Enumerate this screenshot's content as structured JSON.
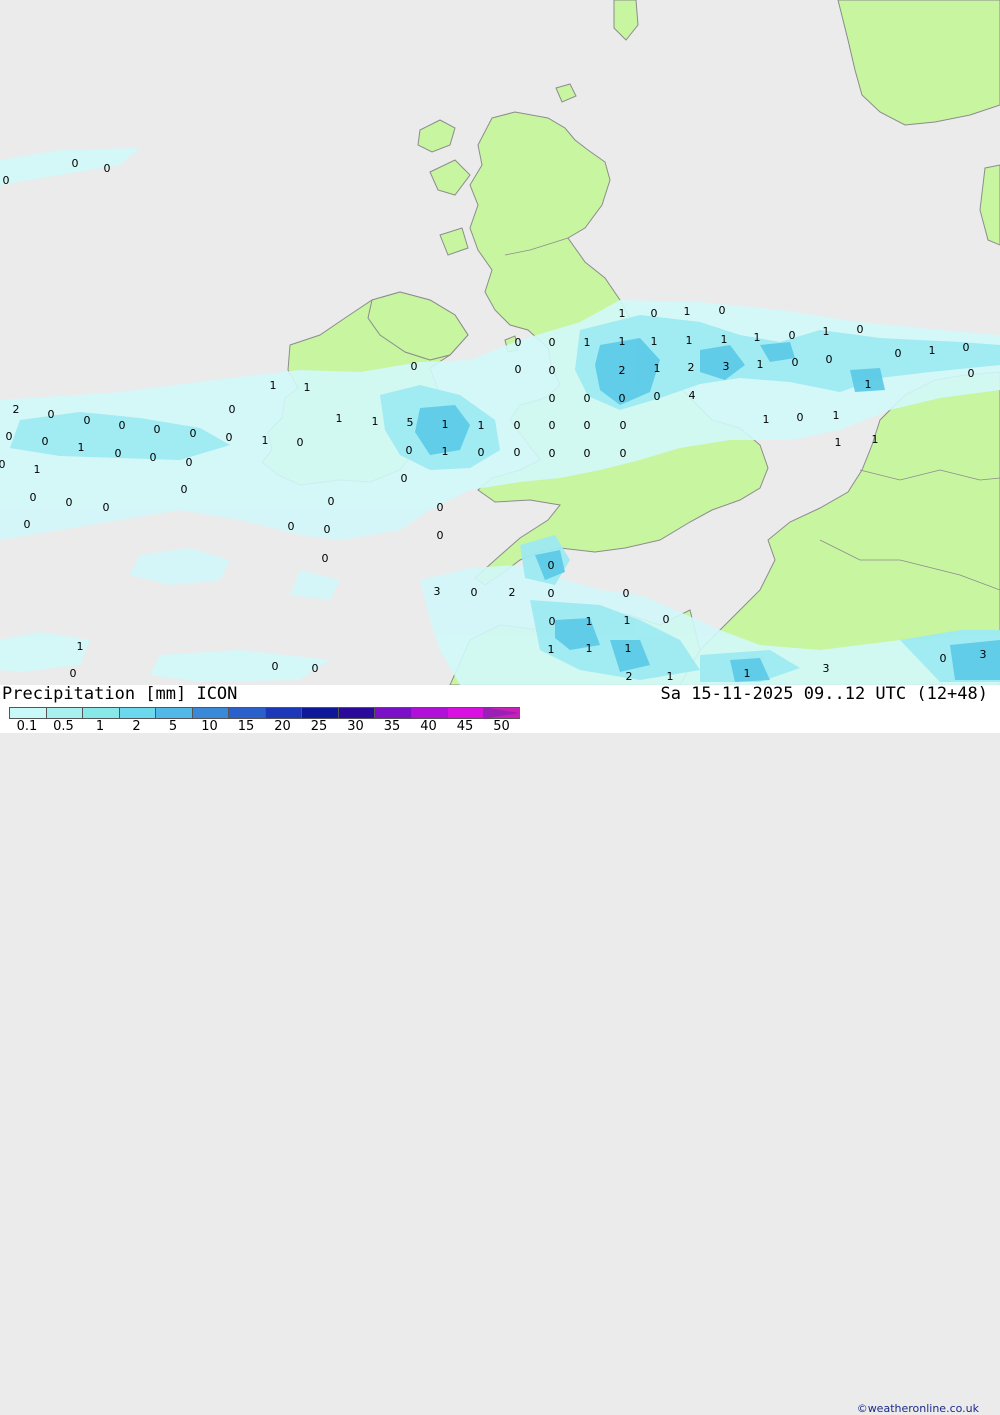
{
  "title": "Precipitation [mm] ICON",
  "valid_time": "Sa 15-11-2025 09..12 UTC (12+48)",
  "credit": "©weatheronline.co.uk",
  "colors": {
    "sea": "#ebebeb",
    "land": "#c8f5a0",
    "coast": "#909090",
    "precip_light": "#d2f8fa",
    "precip_mid": "#9eeaf2",
    "precip_heavy": "#5ecbe8"
  },
  "legend": {
    "ticks": [
      "0.1",
      "0.5",
      "1",
      "2",
      "5",
      "10",
      "15",
      "20",
      "25",
      "30",
      "35",
      "40",
      "45",
      "50"
    ],
    "colors": [
      "#c8f8f8",
      "#a8f0f0",
      "#88e8e8",
      "#6cd8ee",
      "#52b8e8",
      "#3a88d8",
      "#2a60cc",
      "#1c38b8",
      "#10189a",
      "#2a0a9a",
      "#7a10c8",
      "#b010d8",
      "#d810e0",
      "#c820b8"
    ]
  },
  "values": [
    {
      "v": "0"
    },
    {
      "v": "0"
    },
    {
      "v": "0"
    },
    {
      "v": "1"
    },
    {
      "v": "0"
    },
    {
      "v": "1"
    },
    {
      "v": "0"
    },
    {
      "v": "0"
    },
    {
      "v": "0"
    },
    {
      "v": "1"
    },
    {
      "v": "1"
    },
    {
      "v": "1"
    },
    {
      "v": "1"
    },
    {
      "v": "1"
    },
    {
      "v": "1"
    },
    {
      "v": "0"
    },
    {
      "v": "1"
    },
    {
      "v": "0"
    },
    {
      "v": "0"
    },
    {
      "v": "1"
    },
    {
      "v": "1"
    },
    {
      "v": "0"
    },
    {
      "v": "0"
    },
    {
      "v": "2"
    },
    {
      "v": "1"
    },
    {
      "v": "2"
    },
    {
      "v": "3"
    },
    {
      "v": "1"
    },
    {
      "v": "0"
    },
    {
      "v": "0"
    },
    {
      "v": "0"
    },
    {
      "v": "1"
    },
    {
      "v": "0"
    },
    {
      "v": "0"
    },
    {
      "v": "0"
    },
    {
      "v": "0"
    },
    {
      "v": "0"
    },
    {
      "v": "4"
    },
    {
      "v": "1"
    },
    {
      "v": "0"
    },
    {
      "v": "2"
    },
    {
      "v": "0"
    },
    {
      "v": "0"
    },
    {
      "v": "0"
    },
    {
      "v": "0"
    },
    {
      "v": "0"
    },
    {
      "v": "1"
    },
    {
      "v": "1"
    },
    {
      "v": "5"
    },
    {
      "v": "1"
    },
    {
      "v": "1"
    },
    {
      "v": "0"
    },
    {
      "v": "0"
    },
    {
      "v": "0"
    },
    {
      "v": "0"
    },
    {
      "v": "0"
    },
    {
      "v": "0"
    },
    {
      "v": "0"
    },
    {
      "v": "1"
    },
    {
      "v": "0"
    },
    {
      "v": "0"
    },
    {
      "v": "0"
    },
    {
      "v": "0"
    },
    {
      "v": "1"
    },
    {
      "v": "0"
    },
    {
      "v": "0"
    },
    {
      "v": "1"
    },
    {
      "v": "0"
    },
    {
      "v": "0"
    },
    {
      "v": "0"
    },
    {
      "v": "0"
    },
    {
      "v": "0"
    },
    {
      "v": "1"
    },
    {
      "v": "0"
    },
    {
      "v": "1"
    },
    {
      "v": "0"
    },
    {
      "v": "1"
    },
    {
      "v": "1"
    },
    {
      "v": "0"
    },
    {
      "v": "0"
    },
    {
      "v": "0"
    },
    {
      "v": "0"
    },
    {
      "v": "0"
    },
    {
      "v": "0"
    },
    {
      "v": "0"
    },
    {
      "v": "0"
    },
    {
      "v": "0"
    },
    {
      "v": "0"
    },
    {
      "v": "0"
    },
    {
      "v": "3"
    },
    {
      "v": "0"
    },
    {
      "v": "2"
    },
    {
      "v": "0"
    },
    {
      "v": "0"
    },
    {
      "v": "0"
    },
    {
      "v": "0"
    },
    {
      "v": "0"
    },
    {
      "v": "1"
    },
    {
      "v": "1"
    },
    {
      "v": "0"
    },
    {
      "v": "1"
    },
    {
      "v": "1"
    },
    {
      "v": "1"
    },
    {
      "v": "1"
    },
    {
      "v": "0"
    },
    {
      "v": "0"
    },
    {
      "v": "0"
    },
    {
      "v": "2"
    },
    {
      "v": "1"
    },
    {
      "v": "1"
    },
    {
      "v": "3"
    },
    {
      "v": "0"
    },
    {
      "v": "3"
    },
    {
      "v": "1"
    },
    {
      "v": "0"
    }
  ]
}
